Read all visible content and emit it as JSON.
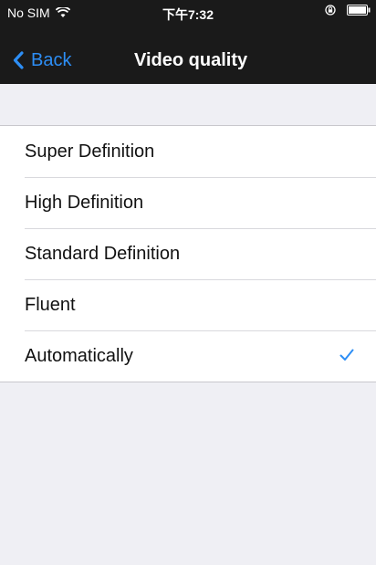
{
  "status_bar": {
    "carrier": "No SIM",
    "time": "下午7:32",
    "wifi_icon": "wifi-icon",
    "lock_icon": "rotation-lock-icon",
    "battery_icon": "battery-icon"
  },
  "nav": {
    "back_label": "Back",
    "back_icon": "chevron-left-icon",
    "title": "Video quality"
  },
  "options": [
    {
      "label": "Super Definition",
      "selected": false
    },
    {
      "label": "High Definition",
      "selected": false
    },
    {
      "label": "Standard Definition",
      "selected": false
    },
    {
      "label": "Fluent",
      "selected": false
    },
    {
      "label": "Automatically",
      "selected": true
    }
  ],
  "colors": {
    "accent": "#2d8ef5",
    "nav_background": "#1a1a1a",
    "page_background": "#efeff4"
  }
}
